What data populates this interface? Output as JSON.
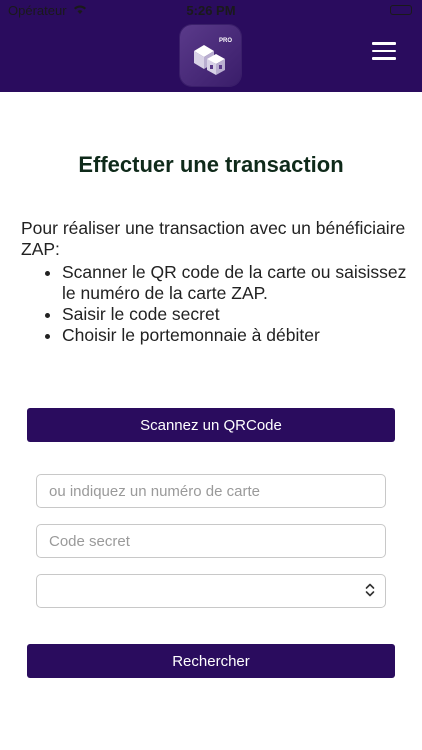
{
  "status_bar": {
    "carrier": "Opérateur",
    "time": "5:26 PM"
  },
  "header": {
    "logo_badge": "PRO"
  },
  "page": {
    "title": "Effectuer une transaction",
    "intro": "Pour réaliser une transaction avec un bénéficiaire ZAP:",
    "steps": [
      "Scanner le QR code de la carte ou saisissez le numéro de la carte ZAP.",
      "Saisir le code secret",
      "Choisir le portemonnaie à débiter"
    ]
  },
  "actions": {
    "scan_label": "Scannez un QRCode",
    "card_placeholder": "ou indiquez un numéro de carte",
    "pin_placeholder": "Code secret",
    "wallet_value": "",
    "search_label": "Rechercher"
  },
  "colors": {
    "brand": "#2a0c5e",
    "title": "#0f2a1a"
  }
}
